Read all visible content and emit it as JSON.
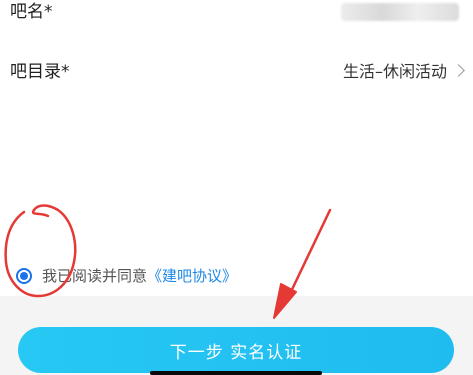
{
  "form": {
    "name_label": "吧名*",
    "directory_label": "吧目录*",
    "directory_value": "生活–休闲活动"
  },
  "agreement": {
    "checked": true,
    "text": "我已阅读并同意",
    "link": "《建吧协议》"
  },
  "actions": {
    "next_label": "下一步 实名认证"
  },
  "colors": {
    "accent": "#1a73e8",
    "link": "#1e88e5",
    "button_start": "#27c8f3",
    "button_end": "#1fbcf0",
    "annotation_red": "#e53935"
  },
  "icons": {
    "directory_chevron": "chevron-right-icon",
    "agreement_radio": "radio-checked-icon"
  }
}
